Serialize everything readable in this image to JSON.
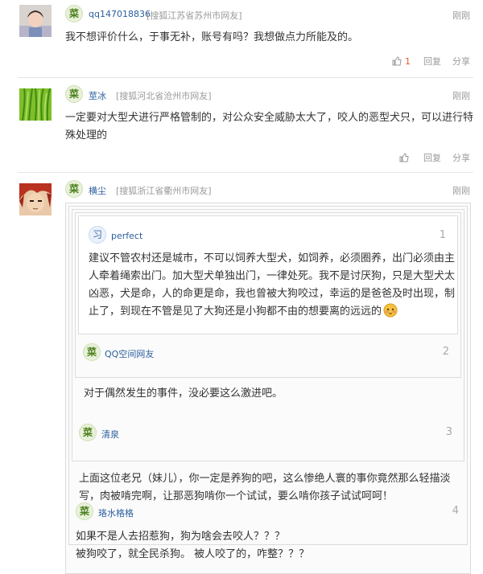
{
  "comments": [
    {
      "user": "qq147018836",
      "location": "[搜狐江苏省苏州市网友]",
      "time": "刚刚",
      "text": "我不想评价什么，于事无补，账号有吗？我想做点力所能及的。",
      "like_count": "1",
      "reply_label": "回复",
      "share_label": "分享"
    },
    {
      "user": "莖冰",
      "location": "[搜狐河北省沧州市网友]",
      "time": "刚刚",
      "text_lines": [
        "一定要对大型犬进行严格管制的，对公众安全威胁太大了，咬人的恶型犬只，可以进行特",
        "殊处理的"
      ],
      "reply_label": "回复",
      "share_label": "分享"
    },
    {
      "user": "横尘",
      "location": "[搜狐浙江省衢州市网友]",
      "time": "刚刚",
      "quotes": [
        {
          "tag": "习",
          "user": "perfect",
          "floor": "1",
          "text_lines": [
            "建议不管农村还是城市，不可以饲养大型犬，如饲养，必须圈养，出门必须由主",
            "人牵着绳索出门。加大型犬单独出门，一律处死。我不是讨厌狗，只是大型犬太",
            "凶恶，犬是命，人的命更是命，我也曾被大狗咬过，幸运的是爸爸及时出现，制",
            "止了，到现在不管是见了大狗还是小狗都不由的想要离的远远的"
          ]
        },
        {
          "tag": "菜",
          "user": "QQ空间网友",
          "floor": "2",
          "text_lines": [
            "对于偶然发生的事件，没必要这么激进吧。"
          ]
        },
        {
          "tag": "菜",
          "user": "清泉",
          "floor": "3",
          "text_lines": [
            "上面这位老兄（妹儿），你一定是养狗的吧，这么惨绝人寰的事你竟然那么轻描淡",
            "写，肉被啃完啊，让那恶狗啃你一个试试，要么啃你孩子试试呵呵！"
          ]
        },
        {
          "tag": "菜",
          "user": "珞水格格",
          "floor": "4",
          "text_lines": [
            "如果不是人去招惹狗，狗为啥会去咬人？？？",
            "被狗咬了，就全民杀狗。 被人咬了的，咋整？？？"
          ]
        }
      ]
    }
  ],
  "tag_label": "菜",
  "colors": {
    "link": "#2b5f9e",
    "meta": "#9a9a9a",
    "like": "#e05a2b",
    "tag_green": "#4a7f1a"
  }
}
